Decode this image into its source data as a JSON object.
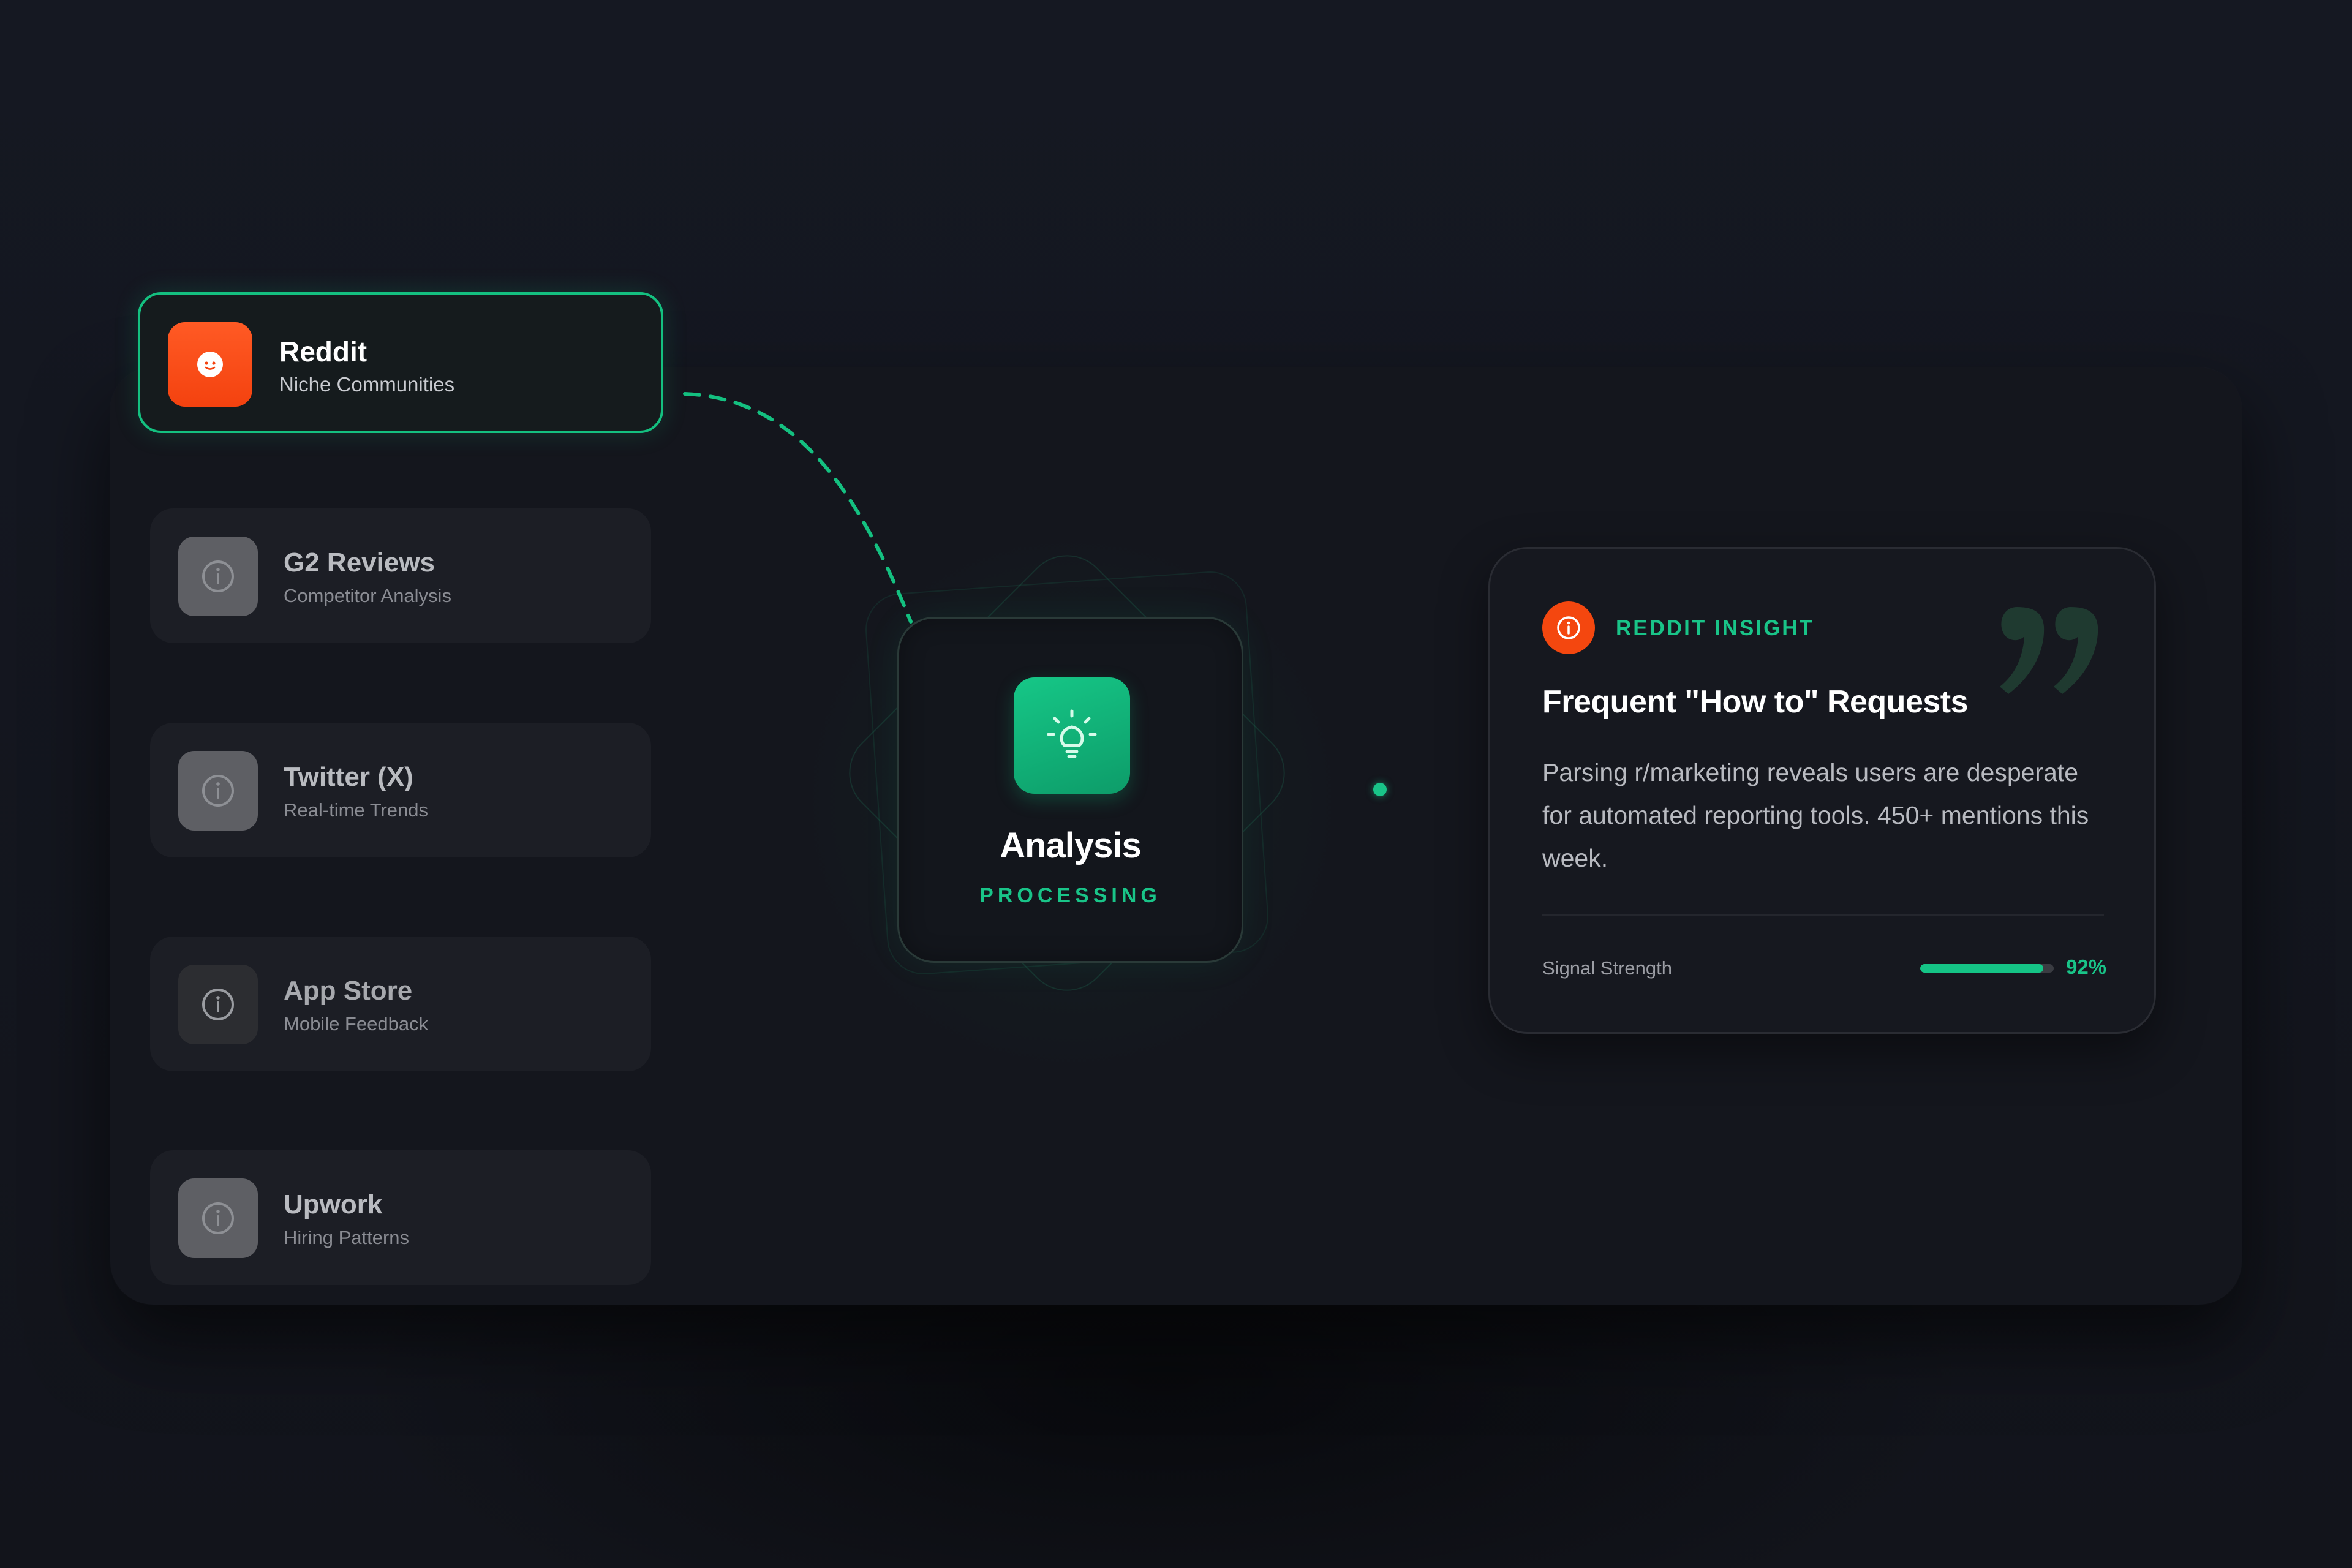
{
  "colors": {
    "accent_green": "#19c488",
    "reddit_orange": "#f4470f",
    "background": "#13151c",
    "card": "#1c1e25"
  },
  "sources": [
    {
      "title": "Reddit",
      "subtitle": "Niche Communities",
      "icon": "reddit-icon",
      "state": "active"
    },
    {
      "title": "G2 Reviews",
      "subtitle": "Competitor Analysis",
      "icon": "info-icon",
      "state": "inactive"
    },
    {
      "title": "Twitter (X)",
      "subtitle": "Real-time Trends",
      "icon": "info-icon",
      "state": "inactive"
    },
    {
      "title": "App Store",
      "subtitle": "Mobile Feedback",
      "icon": "info-icon",
      "state": "dim"
    },
    {
      "title": "Upwork",
      "subtitle": "Hiring Patterns",
      "icon": "info-icon",
      "state": "inactive"
    }
  ],
  "analysis": {
    "title": "Analysis",
    "status": "PROCESSING",
    "icon": "lightbulb-icon"
  },
  "insight": {
    "label": "REDDIT INSIGHT",
    "badge_icon": "info-icon",
    "quote_icon": "quote-icon",
    "headline": "Frequent \"How to\" Requests",
    "body": "Parsing r/marketing reveals users are desperate for automated reporting tools. 450+ mentions this week.",
    "signal_label": "Signal Strength",
    "signal_value": "92%",
    "signal_fraction": 0.92
  }
}
